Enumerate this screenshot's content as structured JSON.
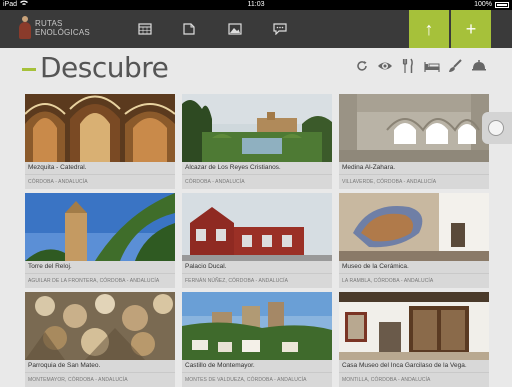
{
  "status": {
    "device": "iPad",
    "time": "11:03",
    "battery": "100%"
  },
  "app": {
    "logo_line1": "RUTAS",
    "logo_line2": "ENOLÓGICAS",
    "nav_icons": [
      "calendar-icon",
      "document-icon",
      "image-icon",
      "chat-icon"
    ],
    "up_button": "↑",
    "add_button": "+"
  },
  "page": {
    "title": "Descubre"
  },
  "tools": [
    "refresh-icon",
    "eye-icon",
    "fork-knife-icon",
    "bed-icon",
    "brush-icon",
    "cloche-icon"
  ],
  "colors": {
    "accent": "#a6c13a",
    "bar": "#3a3a3a",
    "background": "#e9e9e9"
  },
  "cards": [
    {
      "name": "Mezquita - Catedral.",
      "location": "CÓRDOBA - ANDALUCÍA"
    },
    {
      "name": "Alcazar de Los Reyes Cristianos.",
      "location": "CÓRDOBA - ANDALUCÍA"
    },
    {
      "name": "Medina Al-Zahara.",
      "location": "VILLAVERDE, CÓRDOBA - ANDALUCÍA"
    },
    {
      "name": "Torre del Reloj.",
      "location": "AGUILAR DE LA FRONTERA, CÓRDOBA - ANDALUCÍA"
    },
    {
      "name": "Palacio Ducal.",
      "location": "FERNÁN NÚÑEZ, CÓRDOBA - ANDALUCÍA"
    },
    {
      "name": "Museo de la Cerámica.",
      "location": "LA RAMBLA, CÓRDOBA - ANDALUCÍA"
    },
    {
      "name": "Parroquia de San Mateo.",
      "location": "MONTEMAYOR, CÓRDOBA - ANDALUCÍA"
    },
    {
      "name": "Castillo de Montemayor.",
      "location": "MONTES DE VALDUEZA, CÓRDOBA - ANDALUCÍA"
    },
    {
      "name": "Casa Museo del Inca Garcilaso de la Vega.",
      "location": "MONTILLA, CÓRDOBA - ANDALUCÍA"
    }
  ]
}
